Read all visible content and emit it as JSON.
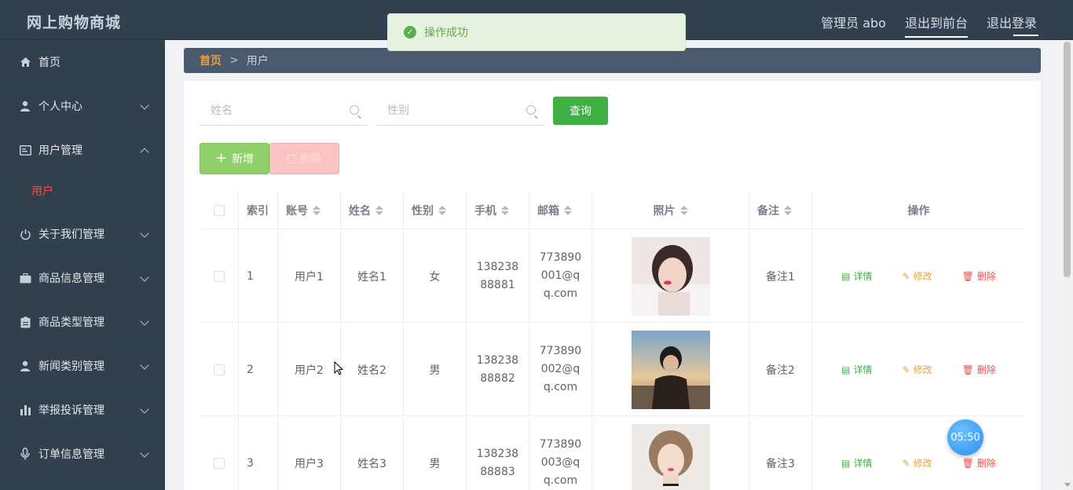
{
  "header": {
    "brand": "网上购物商城",
    "admin_label": "管理员 abo",
    "to_front": "退出到前台",
    "logout": "退出登录"
  },
  "sidebar": {
    "items": [
      {
        "label": "首页",
        "icon": "home-icon"
      },
      {
        "label": "个人中心",
        "icon": "user-icon"
      },
      {
        "label": "用户管理",
        "icon": "id-card-icon"
      },
      {
        "label": "关于我们管理",
        "icon": "power-icon"
      },
      {
        "label": "商品信息管理",
        "icon": "briefcase-icon"
      },
      {
        "label": "商品类型管理",
        "icon": "clipboard-icon"
      },
      {
        "label": "新闻类别管理",
        "icon": "user-icon"
      },
      {
        "label": "举报投诉管理",
        "icon": "bar-chart-icon"
      },
      {
        "label": "订单信息管理",
        "icon": "microphone-icon"
      }
    ],
    "submenu": {
      "label": "用户"
    }
  },
  "breadcrumb": {
    "home": "首页",
    "separator": ">",
    "current": "用户"
  },
  "search": {
    "name_placeholder": "姓名",
    "gender_placeholder": "性别",
    "query_button": "查询"
  },
  "actions": {
    "add": "新增",
    "delete": "删除"
  },
  "table": {
    "headers": {
      "index": "索引",
      "account": "账号",
      "name": "姓名",
      "gender": "性别",
      "phone": "手机",
      "email": "邮箱",
      "photo": "照片",
      "remark": "备注",
      "ops": "操作"
    },
    "rows": [
      {
        "index": "1",
        "account": "用户1",
        "name": "姓名1",
        "gender": "女",
        "phone": "13823888881",
        "email": "773890001@qq.com",
        "remark": "备注1"
      },
      {
        "index": "2",
        "account": "用户2",
        "name": "姓名2",
        "gender": "男",
        "phone": "13823888882",
        "email": "773890002@qq.com",
        "remark": "备注2"
      },
      {
        "index": "3",
        "account": "用户3",
        "name": "姓名3",
        "gender": "男",
        "phone": "13823888883",
        "email": "773890003@qq.com",
        "remark": "备注3"
      }
    ],
    "op_labels": {
      "detail": "详情",
      "edit": "修改",
      "remove": "删除"
    }
  },
  "toast": {
    "message": "操作成功"
  },
  "timer": {
    "value": "05:50"
  },
  "colors": {
    "sidebar_bg": "#323f4f",
    "accent_green": "#3fb043",
    "accent_orange": "#e6a23c",
    "accent_red": "#ef4f4f"
  }
}
